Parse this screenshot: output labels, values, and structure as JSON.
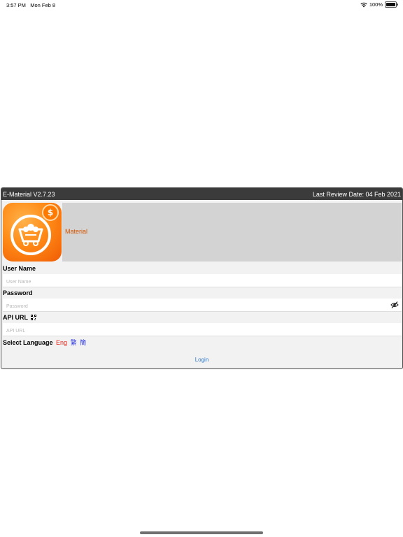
{
  "status_bar": {
    "time": "3:57 PM",
    "date": "Mon Feb 8",
    "battery": "100%"
  },
  "title_bar": {
    "version": "E-Material V2.7.23",
    "review_date": "Last Review Date: 04 Feb 2021"
  },
  "brand": {
    "label": "Material",
    "icon": "mining-cart-coin-icon"
  },
  "form": {
    "username": {
      "label": "User Name",
      "placeholder": "User Name",
      "value": ""
    },
    "password": {
      "label": "Password",
      "placeholder": "Password",
      "value": ""
    },
    "api_url": {
      "label": "API URL",
      "placeholder": "API URL",
      "value": ""
    },
    "language": {
      "label": "Select Language",
      "options": [
        "Eng",
        "繁",
        "簡"
      ],
      "selected": "Eng"
    },
    "login_label": "Login"
  },
  "colors": {
    "title_bar_bg": "#3b3b3b",
    "brand_text": "#d35400",
    "lang_selected": "#e0261c",
    "lang_other": "#2b36e0",
    "link": "#2f78c8"
  }
}
